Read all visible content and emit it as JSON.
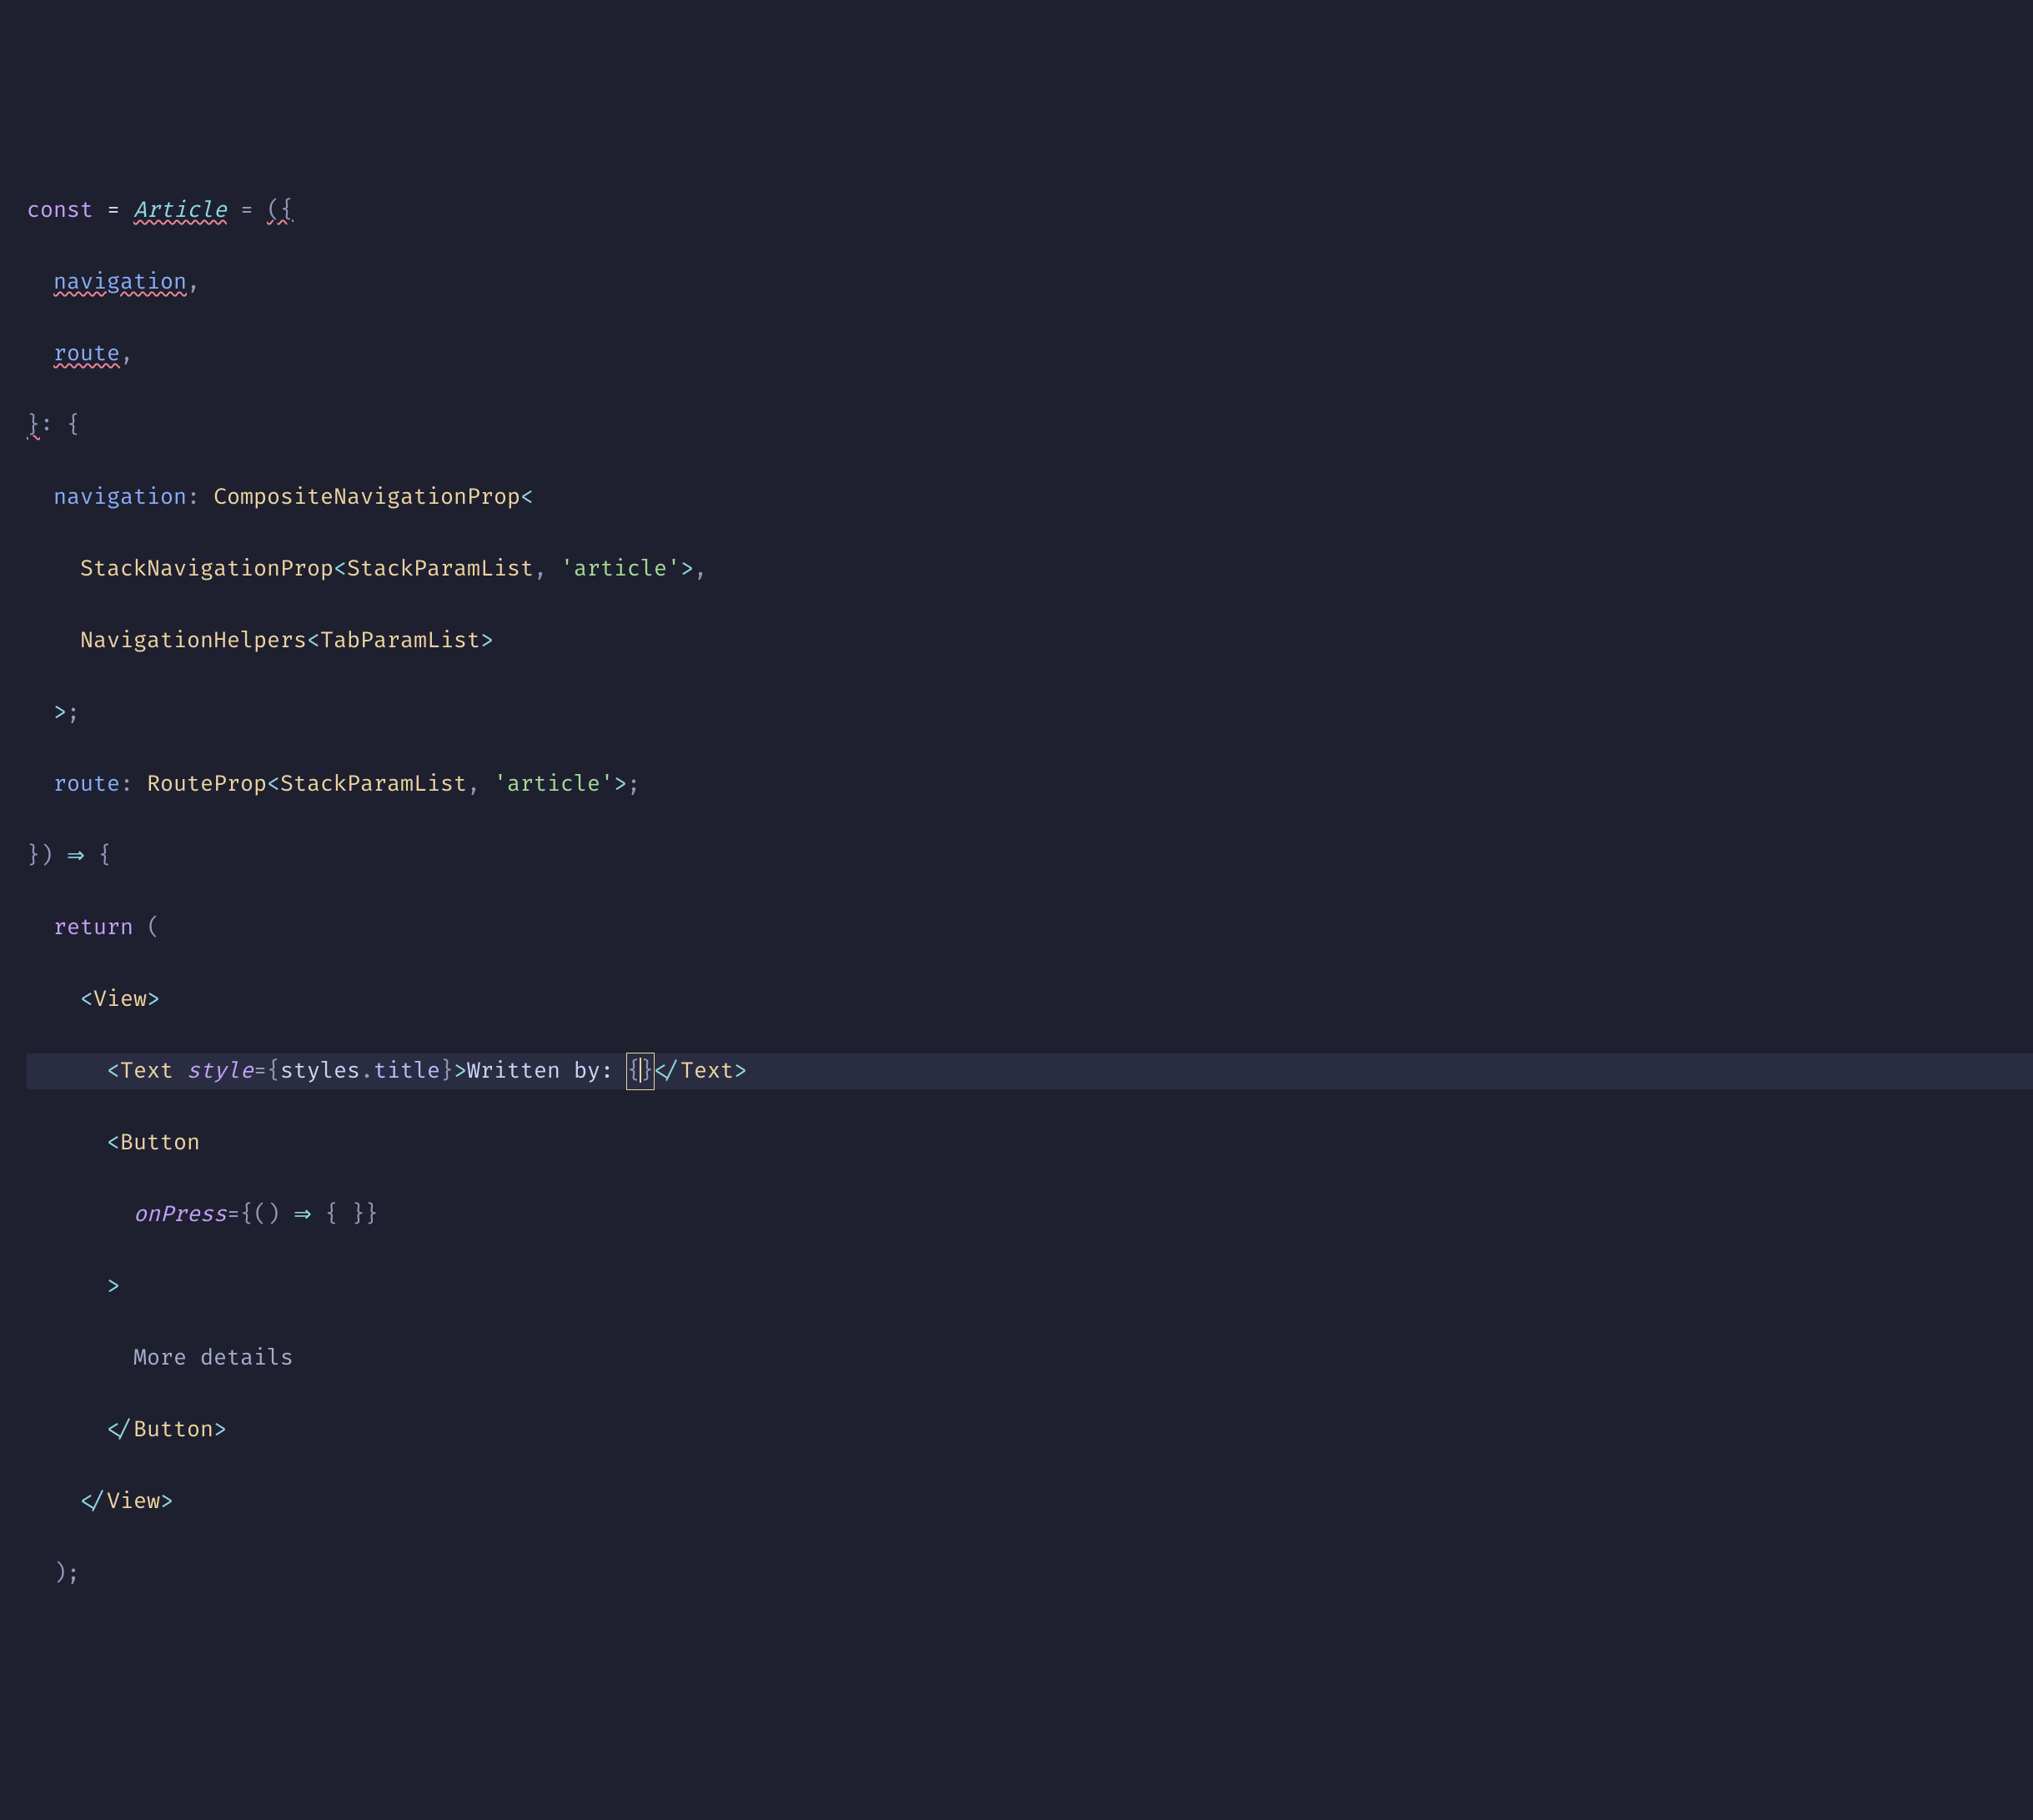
{
  "code": {
    "l1_const": "const",
    "l1_name": "Article",
    "l1_eq": " = ",
    "l1_open": "({",
    "l2_indent": "  ",
    "l2_nav": "navigation",
    "l2_comma": ",",
    "l3_indent": "  ",
    "l3_route": "route",
    "l3_comma": ",",
    "l4_close": "}",
    "l4_colon": ": ",
    "l4_open": "{",
    "l5_indent": "  ",
    "l5_nav": "navigation",
    "l5_colon": ": ",
    "l5_type1": "CompositeNavigationProp",
    "l5_lt": "<",
    "l6_indent": "    ",
    "l6_type1": "StackNavigationProp",
    "l6_lt": "<",
    "l6_type2": "StackParamList",
    "l6_comma": ", ",
    "l6_str": "'article'",
    "l6_gt": ">",
    "l6_endcomma": ",",
    "l7_indent": "    ",
    "l7_type1": "NavigationHelpers",
    "l7_lt": "<",
    "l7_type2": "TabParamList",
    "l7_gt": ">",
    "l8_indent": "  ",
    "l8_gt": ">",
    "l8_semi": ";",
    "l9_indent": "  ",
    "l9_route": "route",
    "l9_colon": ": ",
    "l9_type1": "RouteProp",
    "l9_lt": "<",
    "l9_type2": "StackParamList",
    "l9_comma": ", ",
    "l9_str": "'article'",
    "l9_gt": ">",
    "l9_semi": ";",
    "l10_close": "})",
    "l10_arrow": " ⇒ ",
    "l10_open": "{",
    "l11_indent": "  ",
    "l11_return": "return",
    "l11_paren": " (",
    "l12_indent": "    ",
    "l12_lt": "<",
    "l12_tag": "View",
    "l12_gt": ">",
    "l13_indent": "      ",
    "l13_lt": "<",
    "l13_tag": "Text",
    "l13_sp": " ",
    "l13_attr": "style",
    "l13_eq": "=",
    "l13_ob": "{",
    "l13_obj": "styles",
    "l13_dot": ".",
    "l13_prop": "title",
    "l13_cb": "}",
    "l13_gt": ">",
    "l13_txt": "Written by: ",
    "l13_eb1": "{",
    "l13_eb2": "}",
    "l13_clt": "</",
    "l13_ctag": "Text",
    "l13_cgt": ">",
    "l14_indent": "      ",
    "l14_lt": "<",
    "l14_tag": "Button",
    "l15_indent": "        ",
    "l15_attr": "onPress",
    "l15_eq": "=",
    "l15_ob": "{",
    "l15_po": "(",
    "l15_pc": ")",
    "l15_arrow": " ⇒ ",
    "l15_bo": "{ }",
    "l15_cb": "}",
    "l16_indent": "      ",
    "l16_gt": ">",
    "l17_indent": "        ",
    "l17_txt": "More details",
    "l18_indent": "      ",
    "l18_clt": "</",
    "l18_tag": "Button",
    "l18_cgt": ">",
    "l19_indent": "    ",
    "l19_clt": "</",
    "l19_tag": "View",
    "l19_cgt": ">",
    "l20_indent": "  ",
    "l20_close": ");"
  }
}
